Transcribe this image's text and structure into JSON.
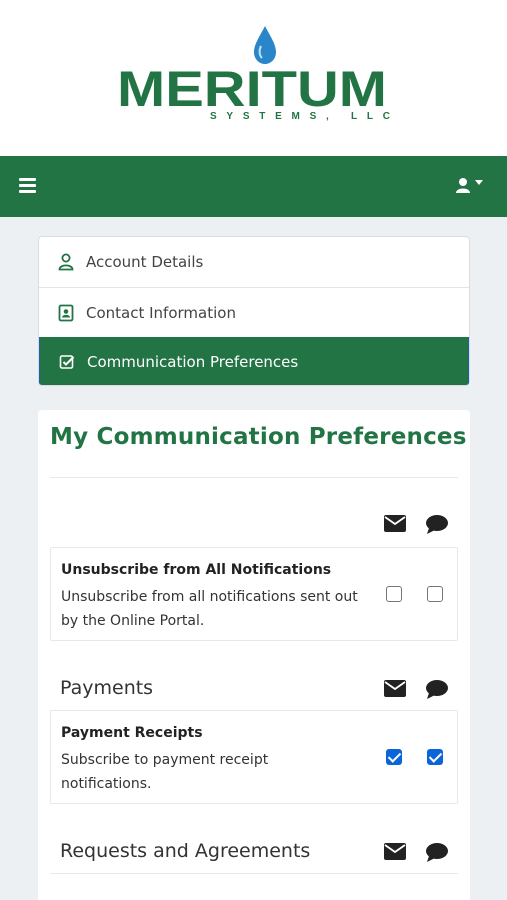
{
  "brand": {
    "name": "MERITUM",
    "tagline": "SYSTEMS, LLC",
    "green": "#227445",
    "drop_blue": "#2a86c9"
  },
  "topbar": {
    "menu_icon": "hamburger-icon",
    "user_icon": "user-icon",
    "caret_icon": "caret-down-icon"
  },
  "nav": {
    "items": [
      {
        "label": "Account Details",
        "icon": "user-outline-icon",
        "active": false
      },
      {
        "label": "Contact Information",
        "icon": "contact-card-icon",
        "active": false
      },
      {
        "label": "Communication Preferences",
        "icon": "check-square-icon",
        "active": true
      }
    ]
  },
  "preferences": {
    "title": "My Communication Preferences",
    "channel_icons": [
      "envelope-icon",
      "comment-icon"
    ],
    "global": {
      "title": "Unsubscribe from All Notifications",
      "description": "Unsubscribe from all notifications sent out by the Online Portal.",
      "email_checked": false,
      "sms_checked": false
    },
    "sections": [
      {
        "label": "Payments",
        "items": [
          {
            "title": "Payment Receipts",
            "description": "Subscribe to payment receipt notifications.",
            "email_checked": true,
            "sms_checked": true
          }
        ]
      },
      {
        "label": "Requests and Agreements",
        "items": []
      }
    ]
  }
}
